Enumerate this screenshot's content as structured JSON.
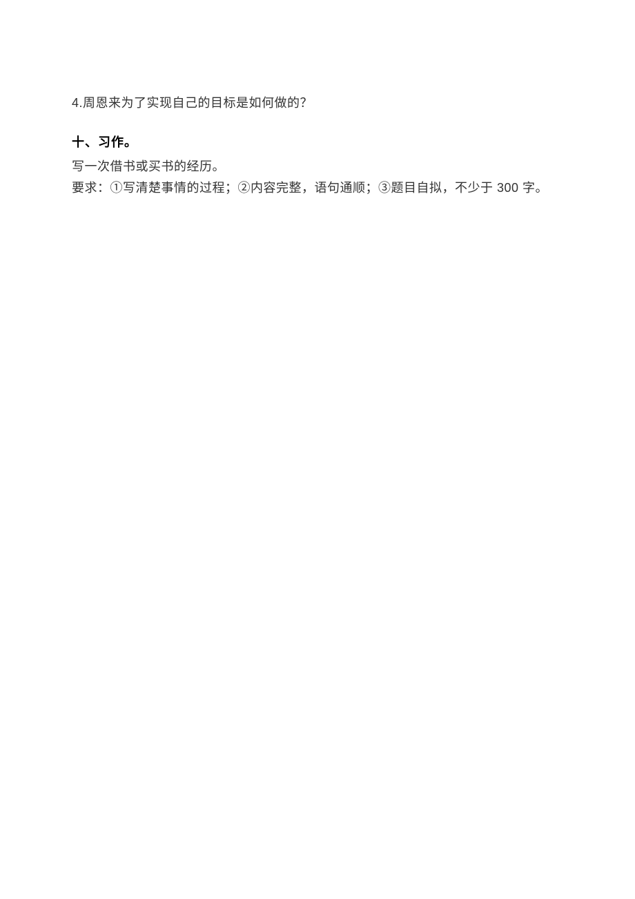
{
  "question4": {
    "text": "4.周恩来为了实现自己的目标是如何做的？"
  },
  "section10": {
    "title": "十、习作。",
    "prompt": "写一次借书或买书的经历。",
    "requirements": "要求：①写清楚事情的过程；②内容完整，语句通顺；③题目自拟，不少于 300 字。"
  }
}
